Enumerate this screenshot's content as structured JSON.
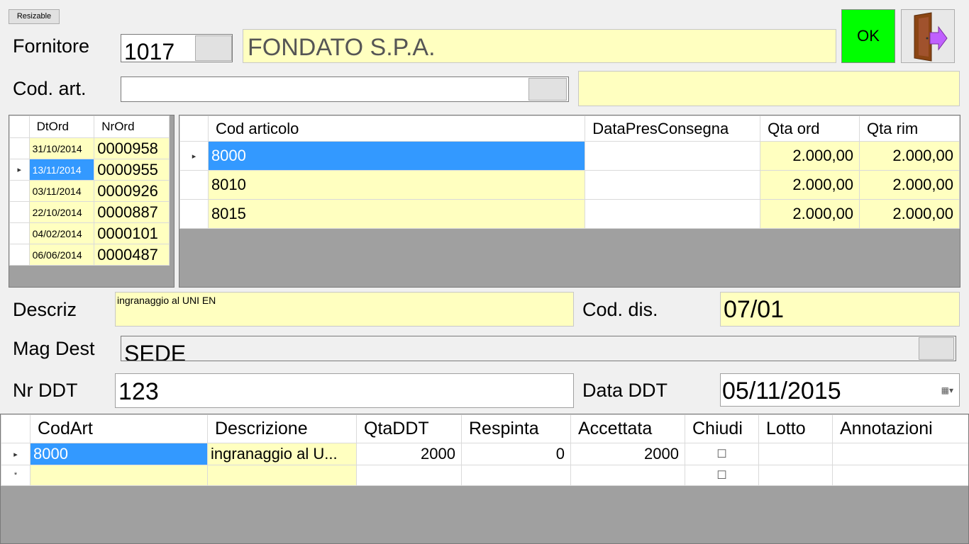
{
  "toolbar": {
    "resizable_label": "Resizable"
  },
  "fornitore": {
    "label": "Fornitore",
    "code": "1017",
    "name": "FONDATO S.P.A."
  },
  "ok_label": "OK",
  "codart": {
    "label": "Cod. art.",
    "value": "",
    "desc": ""
  },
  "orders": {
    "headers": [
      "DtOrd",
      "NrOrd"
    ],
    "rows": [
      {
        "dt": "31/10/2014",
        "nr": "0000958"
      },
      {
        "dt": "13/11/2014",
        "nr": "0000955"
      },
      {
        "dt": "03/11/2014",
        "nr": "0000926"
      },
      {
        "dt": "22/10/2014",
        "nr": "0000887"
      },
      {
        "dt": "04/02/2014",
        "nr": "0000101"
      },
      {
        "dt": "06/06/2014",
        "nr": "0000487"
      }
    ]
  },
  "articles": {
    "headers": [
      "Cod articolo",
      "DataPresConsegna",
      "Qta ord",
      "Qta rim"
    ],
    "rows": [
      {
        "cod": "8000",
        "data": "",
        "ord": "2.000,00",
        "rim": "2.000,00"
      },
      {
        "cod": "8010",
        "data": "",
        "ord": "2.000,00",
        "rim": "2.000,00"
      },
      {
        "cod": "8015",
        "data": "",
        "ord": "2.000,00",
        "rim": "2.000,00"
      }
    ]
  },
  "descriz": {
    "label": "Descriz",
    "value": "ingranaggio al UNI EN"
  },
  "coddis": {
    "label": "Cod. dis.",
    "value": "07/01"
  },
  "magdest": {
    "label": "Mag Dest",
    "value": "SEDE"
  },
  "nrddt": {
    "label": "Nr DDT",
    "value": "123"
  },
  "dataddt": {
    "label": "Data DDT",
    "value": "05/11/2015"
  },
  "ddt": {
    "headers": [
      "CodArt",
      "Descrizione",
      "QtaDDT",
      "Respinta",
      "Accettata",
      "Chiudi",
      "Lotto",
      "Annotazioni"
    ],
    "rows": [
      {
        "marker": "▸",
        "codart": "8000",
        "descr": "ingranaggio al U...",
        "qta": "2000",
        "resp": "0",
        "acc": "2000",
        "chiudi": "☐",
        "lotto": "",
        "note": ""
      },
      {
        "marker": "*",
        "codart": "",
        "descr": "",
        "qta": "",
        "resp": "",
        "acc": "",
        "chiudi": "☐",
        "lotto": "",
        "note": ""
      }
    ]
  }
}
